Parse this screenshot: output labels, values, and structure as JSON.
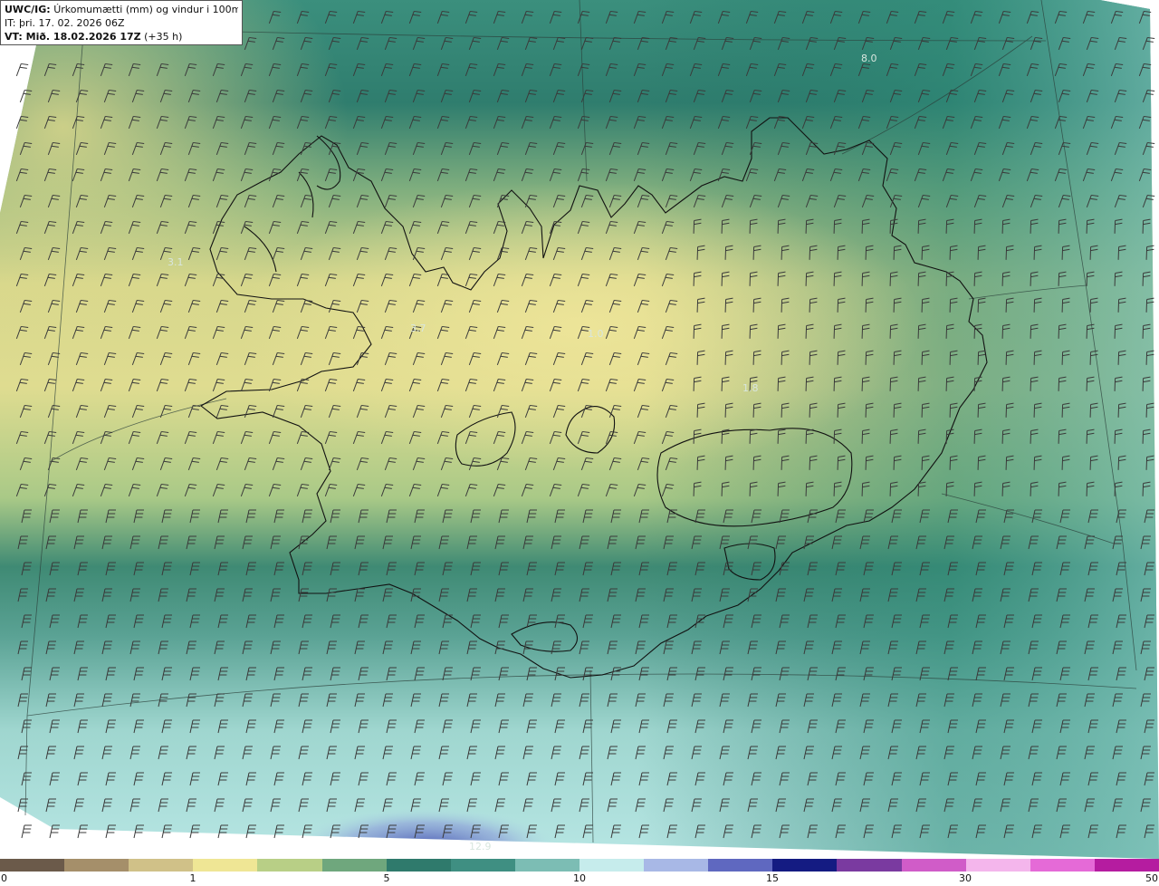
{
  "header": {
    "model_code": "UWC/IG:",
    "title_text": "Úrkomumætti (mm) og vindur i 100m hæð",
    "init_label": "IT: þri. 17. 02. 2026 06Z",
    "valid_prefix": "VT: Mið. 18.02.2026 17Z",
    "valid_suffix": "(+35 h)"
  },
  "value_labels": [
    "8.0",
    "3.1",
    "3.7",
    "1.0",
    "1.8",
    "12.9"
  ],
  "colorbar": {
    "ticks": [
      "0",
      "1",
      "5",
      "10",
      "15",
      "30",
      "50"
    ],
    "colors": [
      "#6b5a4a",
      "#a58f6a",
      "#d0c188",
      "#efe695",
      "#b8cf86",
      "#6fa77d",
      "#2f7a6c",
      "#3f8f82",
      "#7cbdb4",
      "#c6ecec",
      "#a8b8e6",
      "#5f68c0",
      "#141b82",
      "#7a3aa0",
      "#d05cc8",
      "#f4b6ec",
      "#e56ad7",
      "#b51ca0"
    ]
  },
  "colors": {
    "sea_south": "#9fd6cf",
    "sea_north": "#2f7f71",
    "land_dry": "#e8dd93",
    "land_mid": "#9cc58a",
    "heavy": "#5f68c0",
    "coast": "#111111"
  }
}
